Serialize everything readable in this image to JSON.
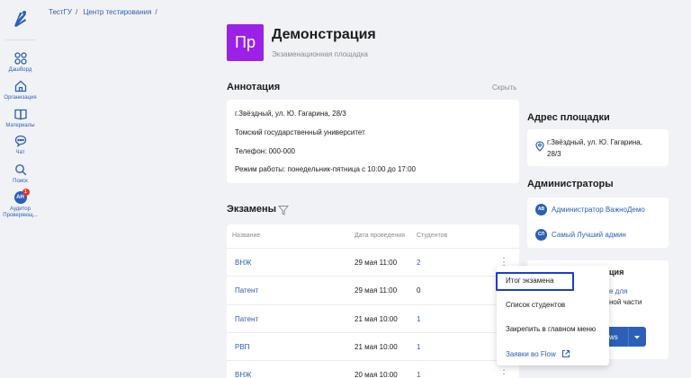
{
  "sidebar": {
    "items": [
      {
        "label": "Дашборд",
        "icon": "grid-icon"
      },
      {
        "label": "Организация",
        "icon": "home-icon"
      },
      {
        "label": "Материалы",
        "icon": "book-icon"
      },
      {
        "label": "Чат",
        "icon": "chat-icon"
      },
      {
        "label": "Поиск",
        "icon": "search-icon"
      },
      {
        "label": "Аудитор Проверяющ...",
        "icon": "avatar-icon",
        "avatar_text": "AH",
        "badge": "1"
      }
    ]
  },
  "breadcrumb": [
    "ТестГУ",
    "Центр тестирования"
  ],
  "header": {
    "tile_text": "Пр",
    "tile_color": "#9b21e6",
    "title": "Демонстрация",
    "subtitle": "Экзаменационная площадка"
  },
  "annotation": {
    "title": "Аннотация",
    "hide_label": "Скрыть",
    "lines": [
      "г.Звёздный, ул. Ю. Гагарина, 28/3",
      "Томский государственный университет",
      "Телефон: 000-000",
      "Режим работы: понедельник-пятница с 10:00 до 17:00"
    ]
  },
  "exams": {
    "title": "Экзамены",
    "columns": [
      "Название",
      "Дата проведения",
      "Студентов"
    ],
    "rows": [
      {
        "name": "ВНЖ",
        "date": "29 мая 11:00",
        "students": "2",
        "students_link": true
      },
      {
        "name": "Патент",
        "date": "29 мая 11:00",
        "students": "0",
        "students_link": false
      },
      {
        "name": "Патент",
        "date": "21 мая 10:00",
        "students": "1",
        "students_link": true
      },
      {
        "name": "РВП",
        "date": "21 мая 10:00",
        "students": "1",
        "students_link": true
      },
      {
        "name": "ВНЖ",
        "date": "20 мая 10:00",
        "students": "1",
        "students_link": true
      }
    ]
  },
  "address": {
    "title": "Адрес площадки",
    "line1": "г.Звёздный, ул. Ю. Гагарина,",
    "line2": "28/3"
  },
  "admins": {
    "title": "Администраторы",
    "items": [
      {
        "initials": "АВ",
        "name": "Администратор ВажноДемо"
      },
      {
        "initials": "СЛ",
        "name": "Самый Лучший админ"
      }
    ]
  },
  "flow": {
    "title_fragment": "ция",
    "text1": "е для",
    "text2": "ной части",
    "button_label": "ws"
  },
  "menu": {
    "items": [
      "Итог экзамена",
      "Список студентов",
      "Закрепить в главном меню",
      "Заявки во Flow"
    ]
  },
  "colors": {
    "accent": "#2b5fb8",
    "highlight_border": "#1b3fc8"
  }
}
